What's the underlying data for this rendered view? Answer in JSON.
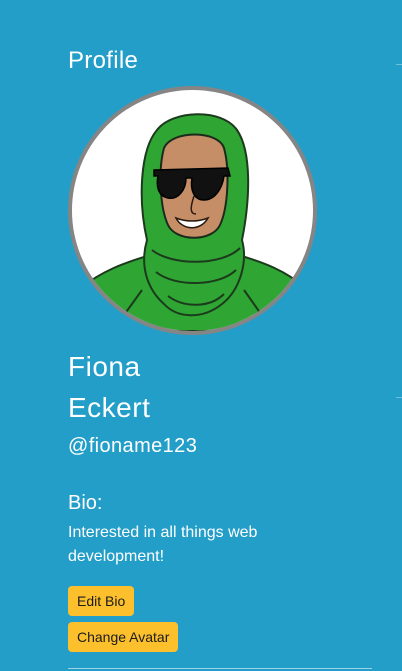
{
  "profile": {
    "heading": "Profile",
    "avatar_alt": "Avatar",
    "first_name": "Fiona",
    "last_name": "Eckert",
    "handle": "@fioname123",
    "bio_label": "Bio:",
    "bio_text": "Interested in all things web development!"
  },
  "actions": {
    "edit_bio": "Edit Bio",
    "change_avatar": "Change Avatar"
  },
  "colors": {
    "background": "#239ec9",
    "button": "#fcc02d",
    "avatar_border": "#858585",
    "hijab": "#2fa534",
    "skin": "#c58e67"
  }
}
